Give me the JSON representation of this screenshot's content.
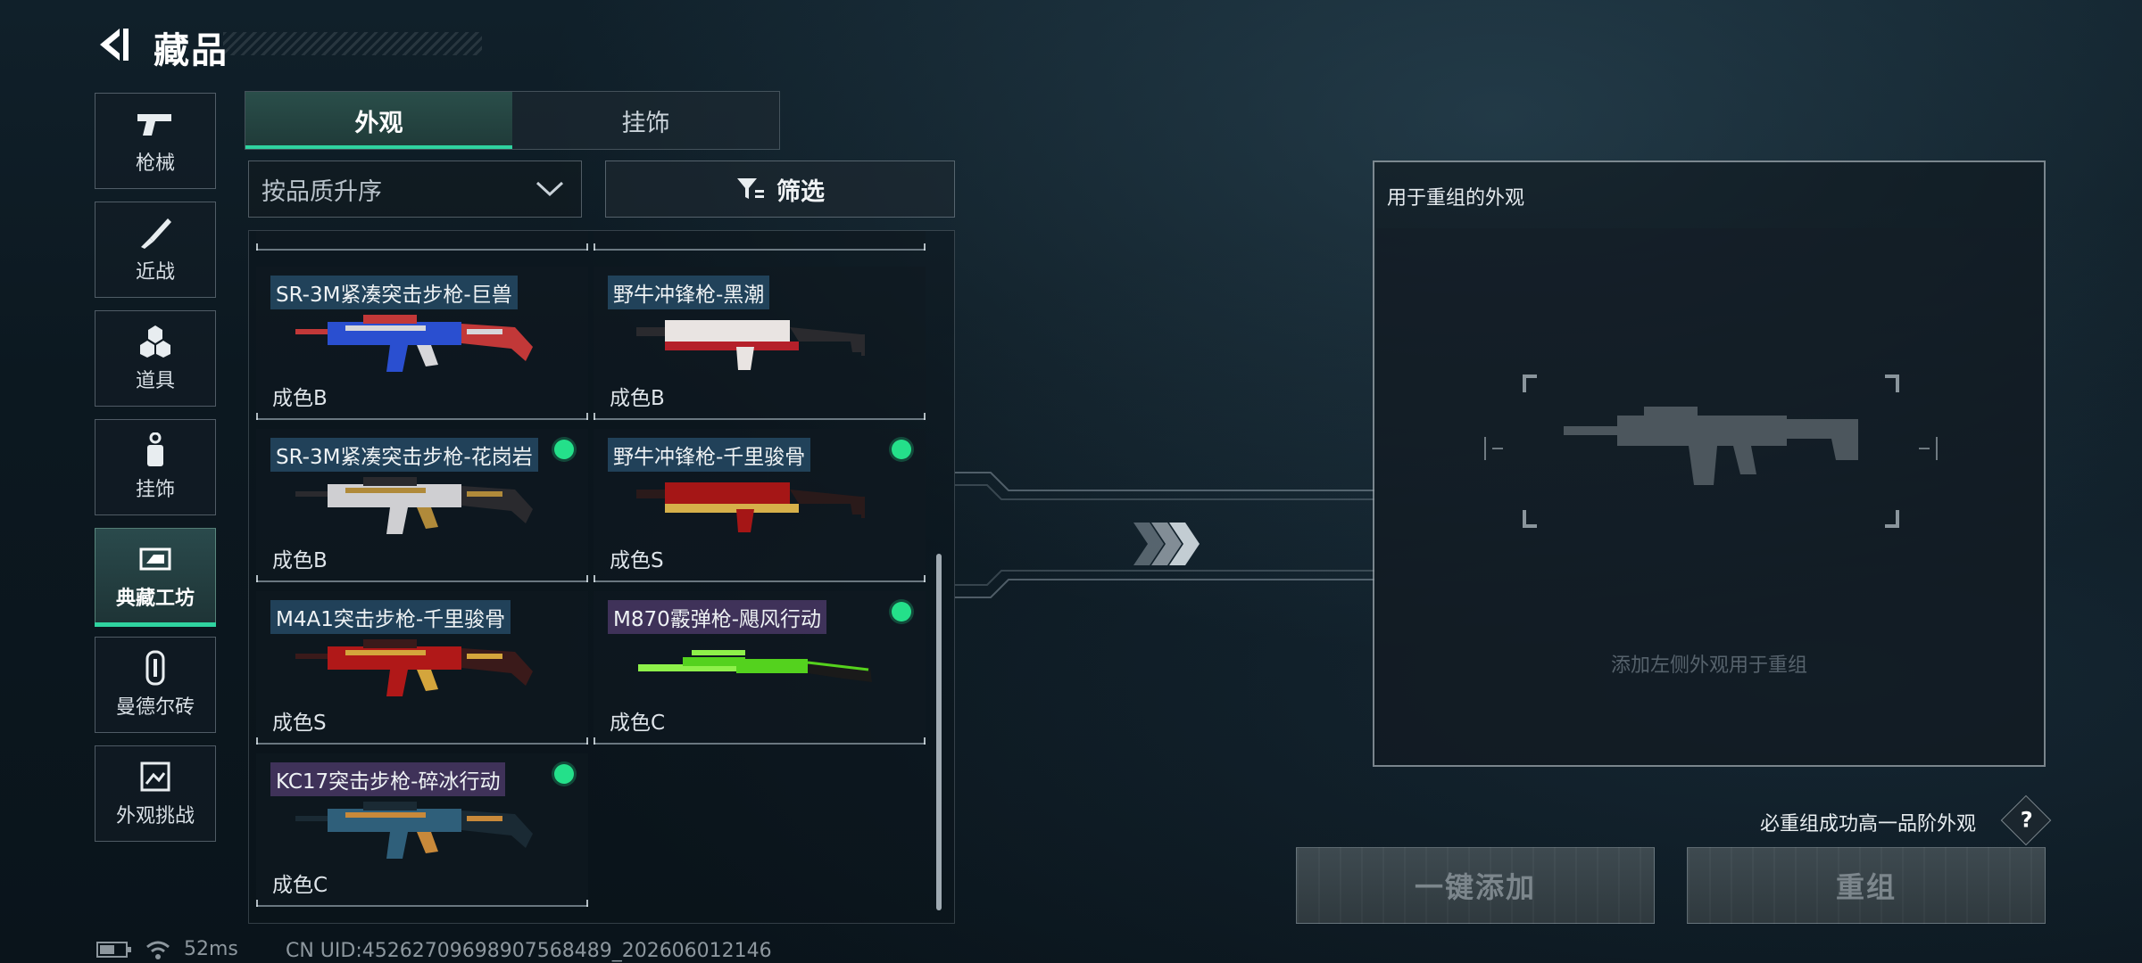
{
  "header": {
    "title": "藏品"
  },
  "nav": {
    "items": [
      {
        "label": "枪械",
        "icon": "pistol-icon"
      },
      {
        "label": "近战",
        "icon": "knife-icon"
      },
      {
        "label": "道具",
        "icon": "grenade-icon"
      },
      {
        "label": "挂饰",
        "icon": "charm-icon"
      },
      {
        "label": "典藏工坊",
        "icon": "workshop-icon",
        "active": true
      },
      {
        "label": "曼德尔砖",
        "icon": "brick-icon"
      },
      {
        "label": "外观挑战",
        "icon": "challenge-icon"
      }
    ]
  },
  "tabs": [
    {
      "label": "外观",
      "active": true
    },
    {
      "label": "挂饰",
      "active": false
    }
  ],
  "sort": {
    "value": "按品质升序"
  },
  "filter": {
    "label": "筛选"
  },
  "list": {
    "items": [
      {
        "name": "SR-3M紧凑突击步枪-巨兽",
        "grade": "成色B",
        "tag_color": "blue",
        "selected": false,
        "palette": [
          "#2a4fd0",
          "#d7d7da",
          "#c23838"
        ]
      },
      {
        "name": "野牛冲锋枪-黑潮",
        "grade": "成色B",
        "tag_color": "blue",
        "selected": false,
        "palette": [
          "#e9e4e2",
          "#b5202a",
          "#2a2a2e"
        ]
      },
      {
        "name": "SR-3M紧凑突击步枪-花岗岩",
        "grade": "成色B",
        "tag_color": "blue",
        "selected": true,
        "palette": [
          "#cfcfd2",
          "#b08a3a",
          "#2a2a2e"
        ]
      },
      {
        "name": "野牛冲锋枪-千里骏骨",
        "grade": "成色S",
        "tag_color": "blue",
        "selected": true,
        "palette": [
          "#a51616",
          "#d6b04a",
          "#2a1a1a"
        ]
      },
      {
        "name": "M4A1突击步枪-千里骏骨",
        "grade": "成色S",
        "tag_color": "blue",
        "selected": false,
        "palette": [
          "#b01818",
          "#d4a53c",
          "#3a1a1a"
        ]
      },
      {
        "name": "M870霰弹枪-飓风行动",
        "grade": "成色C",
        "tag_color": "purple",
        "selected": true,
        "palette": [
          "#54d21e",
          "#1a1a1a",
          "#8ef04a"
        ]
      },
      {
        "name": "KC17突击步枪-碎冰行动",
        "grade": "成色C",
        "tag_color": "purple",
        "selected": true,
        "palette": [
          "#2f5f7a",
          "#c8893a",
          "#1a2a34"
        ]
      }
    ]
  },
  "recombine": {
    "title": "用于重组的外观",
    "hint": "添加左侧外观用于重组",
    "info": "必重组成功高一品阶外观",
    "help_label": "?",
    "add_all_label": "一键添加",
    "recombine_label": "重组"
  },
  "status": {
    "ping": "52ms",
    "uid": "CN UID:45262709698907568489_202606012146"
  },
  "colors": {
    "accent": "#2fd3a0",
    "selected_dot": "#24e08a"
  }
}
